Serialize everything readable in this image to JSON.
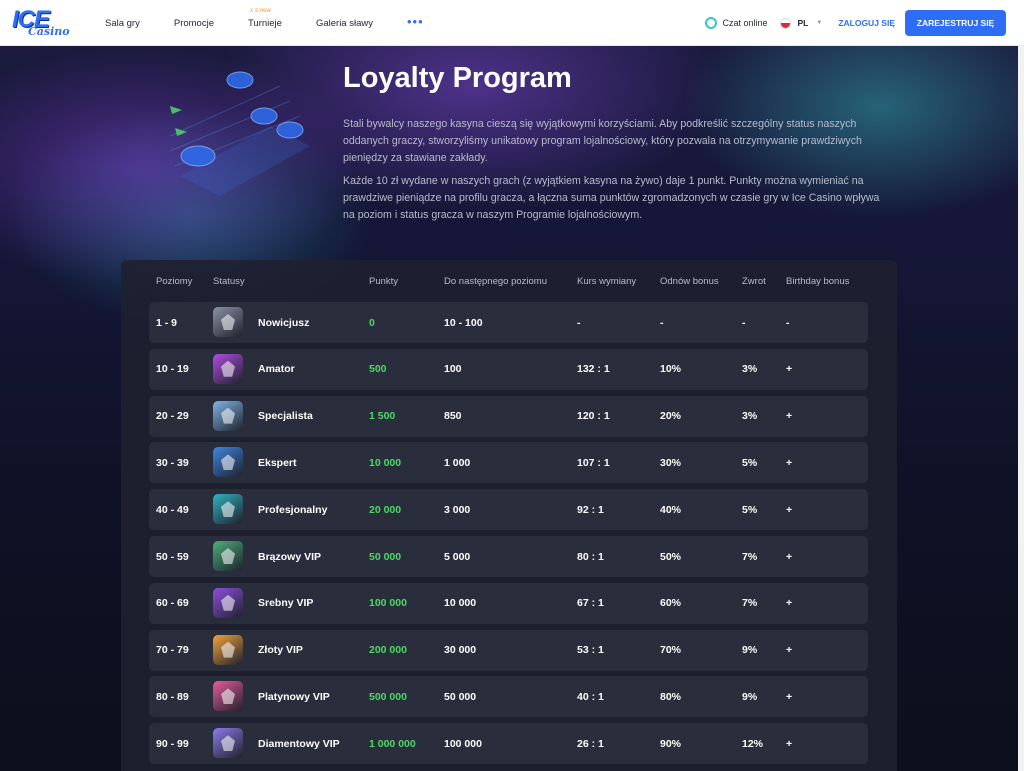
{
  "header": {
    "logo_main": "ICE",
    "logo_sub": "Casino",
    "nav": [
      {
        "label": "Sala gry",
        "tag": ""
      },
      {
        "label": "Promocje",
        "tag": ""
      },
      {
        "label": "Turnieje",
        "tag": "x ≡ new"
      },
      {
        "label": "Galeria sławy",
        "tag": ""
      }
    ],
    "more": "•••",
    "chat": "Czat online",
    "lang": "PL",
    "login": "ZALOGUJ SIĘ",
    "register": "ZAREJESTRUJ SIĘ"
  },
  "hero": {
    "title": "Loyalty Program",
    "p1": "Stali bywalcy naszego kasyna cieszą się wyjątkowymi korzyściami. Aby podkreślić szczególny status naszych oddanych graczy, stworzyliśmy unikatowy program lojalnościowy, który pozwala na otrzymywanie prawdziwych pieniędzy za stawiane zakłady.",
    "p2": "Każde 10 zł wydane w naszych grach (z wyjątkiem kasyna na żywo) daje 1 punkt. Punkty można wymieniać na prawdziwe pieniądze na profilu gracza, a łączna suma punktów zgromadzonych w czasie gry w Ice Casino wpływa na poziom i status gracza w naszym Programie lojalnościowym."
  },
  "table": {
    "headers": [
      "Poziomy",
      "Statusy",
      "Punkty",
      "Do następnego poziomu",
      "Kurs wymiany",
      "Odnów bonus",
      "Zwrot",
      "Birthday bonus"
    ],
    "rows": [
      {
        "level": "1 - 9",
        "status": "Nowicjusz",
        "points": "0",
        "next": "10 - 100",
        "rate": "-",
        "renew": "-",
        "cashback": "-",
        "birthday": "-",
        "color": "#8b93a7"
      },
      {
        "level": "10 - 19",
        "status": "Amator",
        "points": "500",
        "next": "100",
        "rate": "132 : 1",
        "renew": "10%",
        "cashback": "3%",
        "birthday": "+",
        "color": "#b04de0"
      },
      {
        "level": "20 - 29",
        "status": "Specjalista",
        "points": "1 500",
        "next": "850",
        "rate": "120 : 1",
        "renew": "20%",
        "cashback": "3%",
        "birthday": "+",
        "color": "#7fb6e8"
      },
      {
        "level": "30 - 39",
        "status": "Ekspert",
        "points": "10 000",
        "next": "1 000",
        "rate": "107 : 1",
        "renew": "30%",
        "cashback": "5%",
        "birthday": "+",
        "color": "#3f86e0"
      },
      {
        "level": "40 - 49",
        "status": "Profesjonalny",
        "points": "20 000",
        "next": "3 000",
        "rate": "92 : 1",
        "renew": "40%",
        "cashback": "5%",
        "birthday": "+",
        "color": "#2fb3c0"
      },
      {
        "level": "50 - 59",
        "status": "Brązowy VIP",
        "points": "50 000",
        "next": "5 000",
        "rate": "80 : 1",
        "renew": "50%",
        "cashback": "7%",
        "birthday": "+",
        "color": "#4caf7a"
      },
      {
        "level": "60 - 69",
        "status": "Srebny VIP",
        "points": "100 000",
        "next": "10 000",
        "rate": "67 : 1",
        "renew": "60%",
        "cashback": "7%",
        "birthday": "+",
        "color": "#8f4fe0"
      },
      {
        "level": "70 - 79",
        "status": "Złoty VIP",
        "points": "200 000",
        "next": "30 000",
        "rate": "53 : 1",
        "renew": "70%",
        "cashback": "9%",
        "birthday": "+",
        "color": "#f2a23a"
      },
      {
        "level": "80 - 89",
        "status": "Platynowy VIP",
        "points": "500 000",
        "next": "50 000",
        "rate": "40 : 1",
        "renew": "80%",
        "cashback": "9%",
        "birthday": "+",
        "color": "#e85a9c"
      },
      {
        "level": "90 - 99",
        "status": "Diamentowy VIP",
        "points": "1 000 000",
        "next": "100 000",
        "rate": "26 : 1",
        "renew": "90%",
        "cashback": "12%",
        "birthday": "+",
        "color": "#8e7bea"
      }
    ]
  }
}
